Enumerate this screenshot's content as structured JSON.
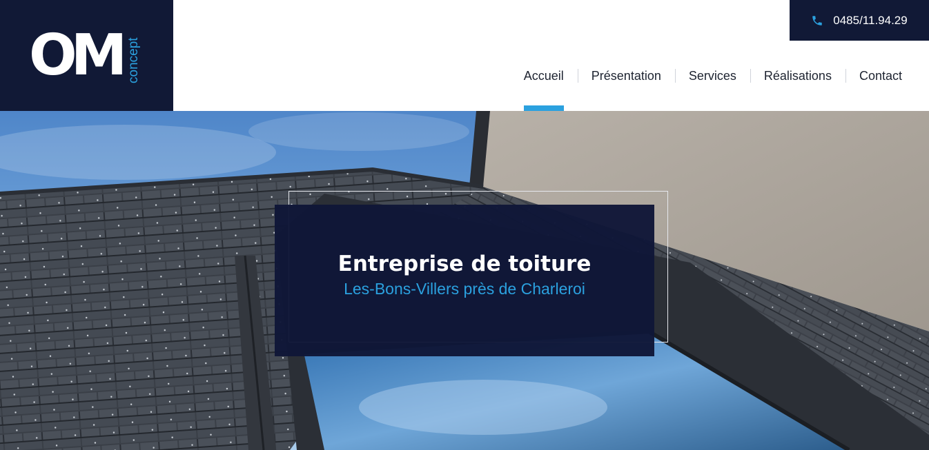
{
  "brand": {
    "logo_mark": "OM",
    "logo_sub": "concept",
    "colors": {
      "navy": "#111936",
      "accent": "#2ba1df"
    }
  },
  "contact": {
    "icon": "phone-icon",
    "phone": "0485/11.94.29"
  },
  "nav": {
    "items": [
      {
        "label": "Accueil",
        "active": true
      },
      {
        "label": "Présentation"
      },
      {
        "label": "Services"
      },
      {
        "label": "Réalisations"
      },
      {
        "label": "Contact"
      }
    ]
  },
  "hero": {
    "title": "Entreprise de toiture",
    "subtitle": "Les-Bons-Villers près de Charleroi"
  }
}
